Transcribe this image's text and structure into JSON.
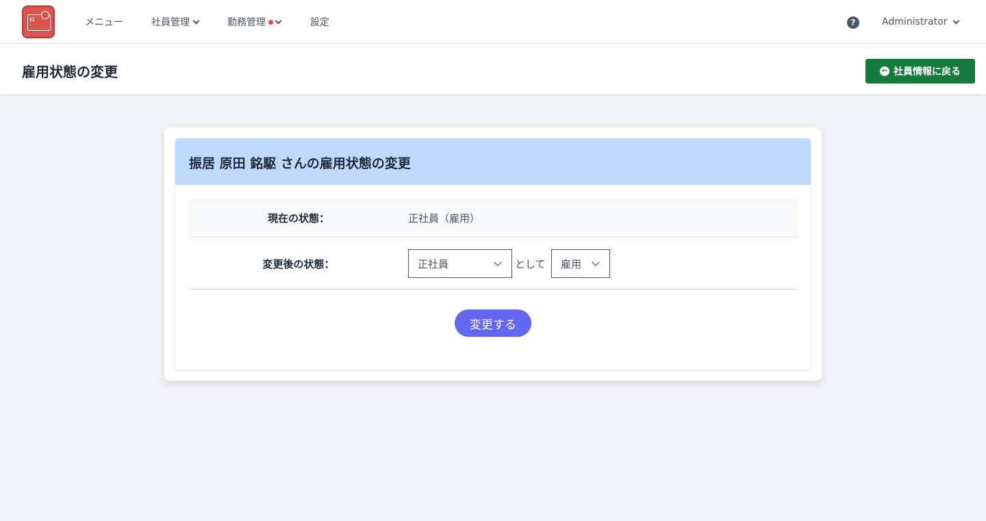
{
  "nav": {
    "items": [
      {
        "label": "メニュー"
      },
      {
        "label": "社員管理"
      },
      {
        "label": "勤務管理"
      },
      {
        "label": "設定"
      }
    ],
    "user": "Administrator",
    "help_icon": "?"
  },
  "header": {
    "title": "雇用状態の変更",
    "back_button": "社員情報に戻る"
  },
  "card": {
    "title": "振居 原田 銘駆 さんの雇用状態の変更",
    "current_label": "現在の状態：",
    "current_value": "正社員（雇用）",
    "after_label": "変更後の状態：",
    "type_select": "正社員",
    "as_text": "として",
    "employment_select": "雇用",
    "submit": "変更する"
  },
  "colors": {
    "brand": "#d9534f",
    "back_button": "#157a3c",
    "card_header": "#bfdbfe",
    "submit": "#6366f1",
    "notification_dot": "#ef4444"
  }
}
